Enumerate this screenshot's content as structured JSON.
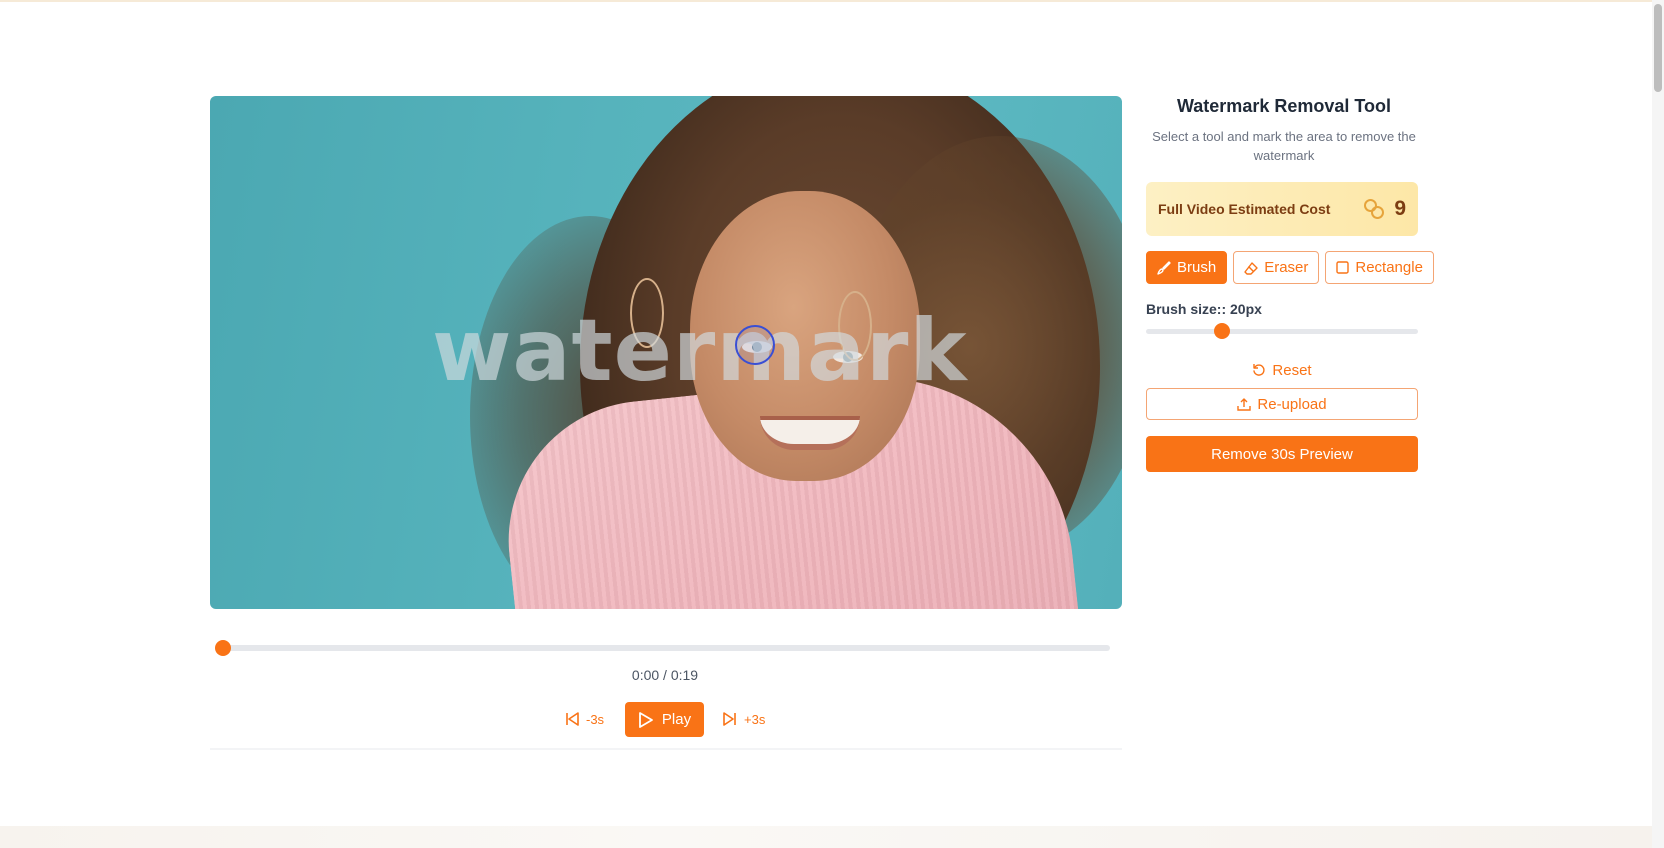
{
  "video": {
    "watermark_text": "watermark",
    "current_time": "0:00 / 0:19",
    "progress": 0,
    "controls": {
      "back_label": "-3s",
      "play_label": "Play",
      "forward_label": "+3s"
    }
  },
  "panel": {
    "title": "Watermark Removal Tool",
    "subtitle": "Select a tool and mark the area to remove the watermark",
    "cost": {
      "label": "Full Video Estimated Cost",
      "value": "9",
      "icon": "coins-icon"
    },
    "tools": [
      {
        "label": "Brush",
        "icon": "brush-icon",
        "active": true
      },
      {
        "label": "Eraser",
        "icon": "eraser-icon",
        "active": false
      },
      {
        "label": "Rectangle",
        "icon": "square-icon",
        "active": false
      }
    ],
    "brush_size_label": "Brush size:: 20px",
    "brush_size_fraction": 0.28,
    "reset_label": "Reset",
    "reupload_label": "Re-upload",
    "remove_label": "Remove 30s Preview"
  },
  "colors": {
    "accent": "#f97316",
    "cost_bg": "#fde7a7",
    "cost_text": "#7c3d12"
  }
}
